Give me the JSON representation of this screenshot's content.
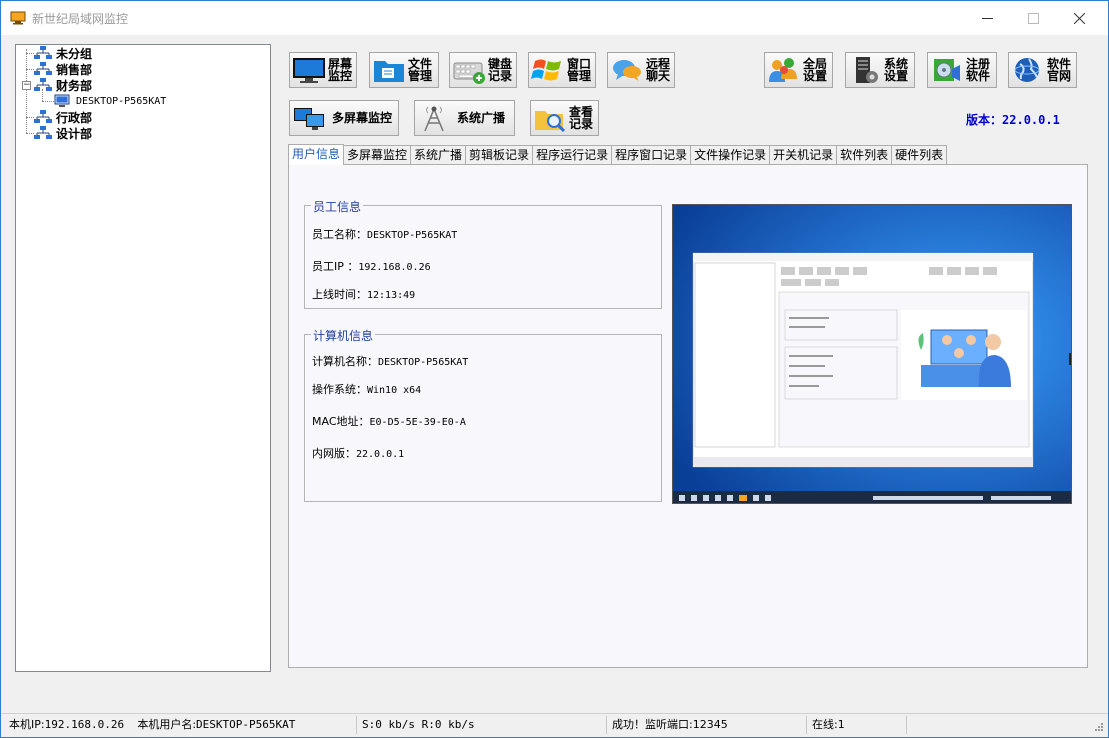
{
  "window": {
    "title": "新世纪局域网监控"
  },
  "tree": [
    {
      "label": "未分组",
      "type": "group"
    },
    {
      "label": "销售部",
      "type": "group"
    },
    {
      "label": "财务部",
      "type": "group",
      "expanded": true
    },
    {
      "label": "DESKTOP-P565KAT",
      "type": "computer"
    },
    {
      "label": "行政部",
      "type": "group"
    },
    {
      "label": "设计部",
      "type": "group"
    }
  ],
  "toolbar": {
    "screen_monitor": "屏幕\n监控",
    "file_manage": "文件\n管理",
    "keyboard_log": "键盘\n记录",
    "window_manage": "窗口\n管理",
    "remote_chat": "远程\n聊天",
    "global_settings": "全局\n设置",
    "system_settings": "系统\n设置",
    "register": "注册\n软件",
    "website": "软件\n官网",
    "multi_screen": "多屏幕监控",
    "broadcast": "系统广播",
    "view_records": "查看\n记录"
  },
  "version": {
    "label": "版本：",
    "value": "22.0.0.1"
  },
  "tabs": [
    "用户信息",
    "多屏幕监控",
    "系统广播",
    "剪辑板记录",
    "程序运行记录",
    "程序窗口记录",
    "文件操作记录",
    "开关机记录",
    "软件列表",
    "硬件列表"
  ],
  "employee": {
    "legend": "员工信息",
    "name_label": "员工名称：",
    "name": "DESKTOP-P565KAT",
    "ip_label": "员工IP ：",
    "ip": "192.168.0.26",
    "online_label": "上线时间：",
    "online": "12:13:49"
  },
  "computer": {
    "legend": "计算机信息",
    "name_label": "计算机名称：",
    "name": "DESKTOP-P565KAT",
    "os_label": "操作系统：",
    "os": "Win10 x64",
    "mac_label": "MAC地址：",
    "mac": "E0-D5-5E-39-E0-A",
    "intranet_label": "内网版：",
    "intranet": "22.0.0.1"
  },
  "status": {
    "local_ip_label": "本机IP:",
    "local_ip": "192.168.0.26",
    "user_label": "本机用户名:",
    "user": "DESKTOP-P565KAT",
    "speed": "S:0 kb/s R:0 kb/s",
    "result": "成功！监听端口:12345",
    "online": "在线:1"
  },
  "colors": {
    "accent": "#0000d0",
    "tab_active": "#1f5fb4",
    "legend": "#1f3fa0",
    "desktop_bg": "#1a5fc0"
  }
}
